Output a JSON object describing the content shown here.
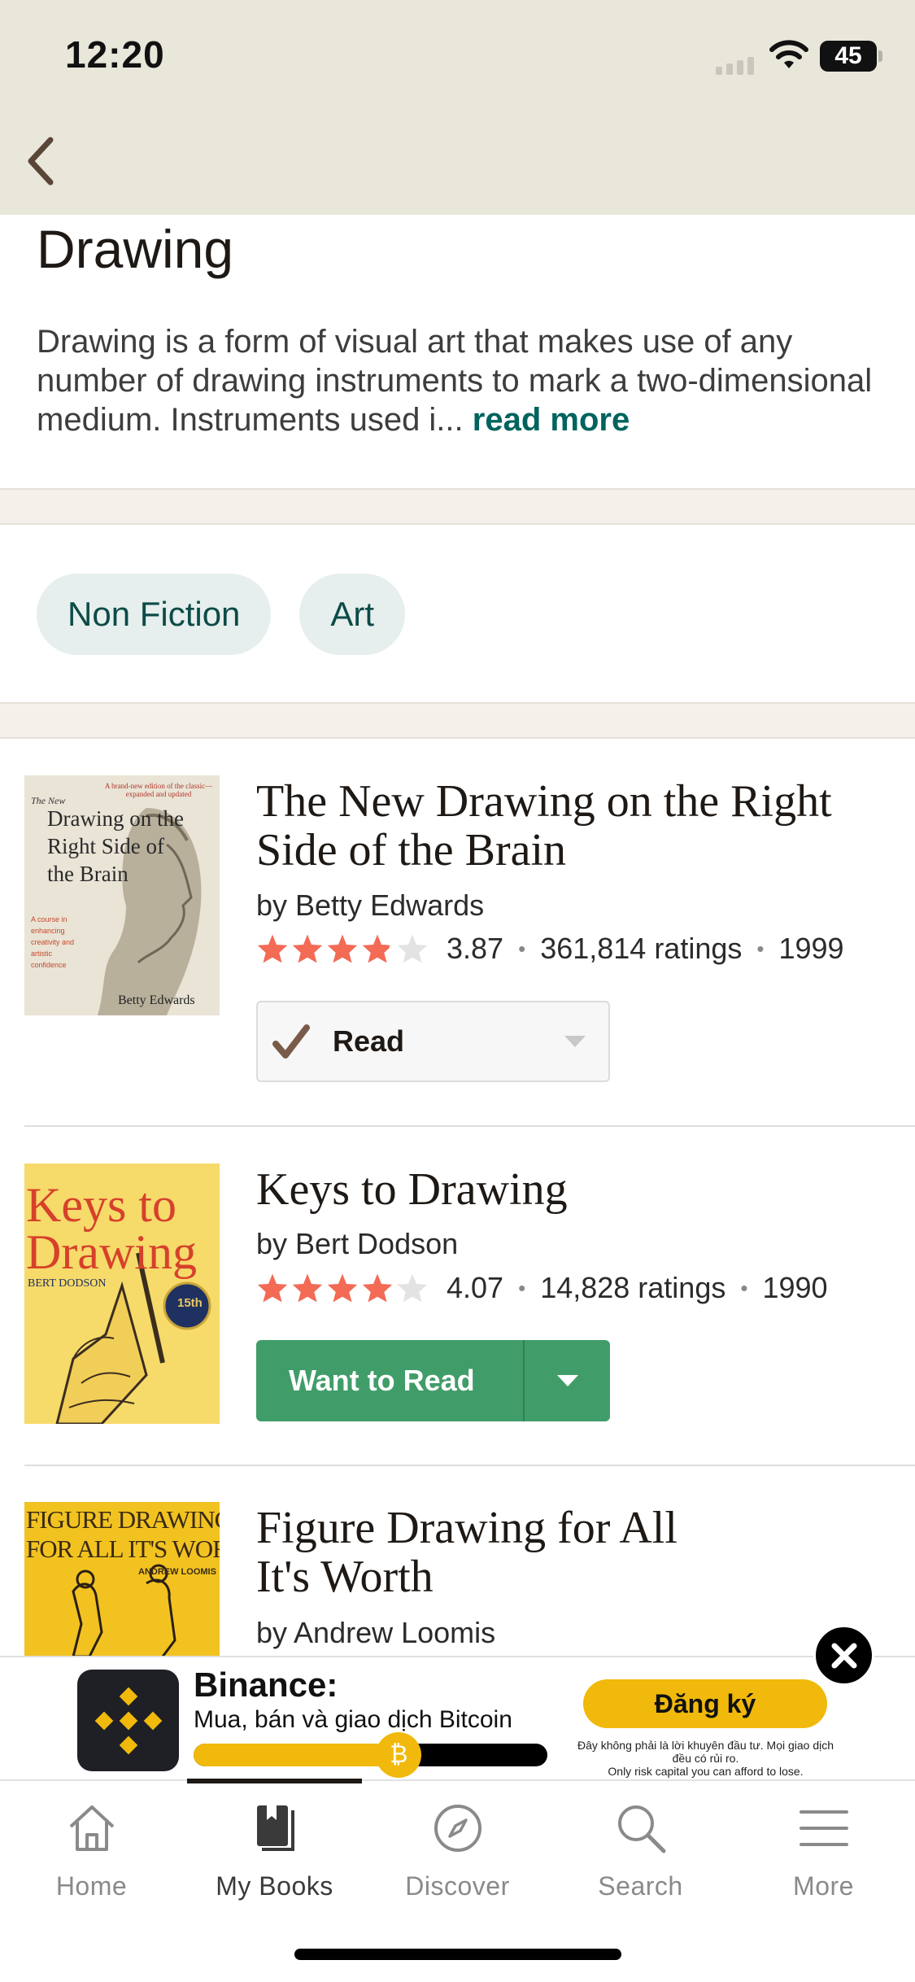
{
  "status_bar": {
    "time": "12:20",
    "battery": "45"
  },
  "genre": {
    "title": "Drawing",
    "description": "Drawing is a form of visual art that makes use of any number of drawing instruments to mark a two-dimensional medium. Instruments used i...",
    "read_more": "read more"
  },
  "tags": [
    "Non Fiction",
    "Art"
  ],
  "books": [
    {
      "title": "The New Drawing on the Right Side of the Brain",
      "author": "by Betty Edwards",
      "rating": "3.87",
      "ratings_count": "361,814 ratings",
      "year": "1999",
      "stars_filled": 3.87,
      "shelf_label": "Read",
      "cover": {
        "small_top": "A brand-new edition of the classic—expanded and updated",
        "the_new": "The New",
        "line1": "Drawing on the",
        "line2": "Right Side of",
        "line3": "the Brain",
        "side_text": "A course in enhancing creativity and artistic confidence",
        "author": "Betty Edwards"
      }
    },
    {
      "title": "Keys to Drawing",
      "author": "by Bert Dodson",
      "rating": "4.07",
      "ratings_count": "14,828 ratings",
      "year": "1990",
      "stars_filled": 4.07,
      "shelf_label": "Want to Read",
      "cover": {
        "line1": "Keys to",
        "line2": "Drawing",
        "author": "BERT DODSON",
        "badge": "15th"
      }
    },
    {
      "title": "Figure Drawing for All It's Worth",
      "author": "by Andrew Loomis",
      "cover": {
        "line1": "FIGURE DRAWING",
        "line2": "FOR ALL IT'S WORTH",
        "author": "ANDREW LOOMIS"
      }
    }
  ],
  "ad": {
    "title": "Binance:",
    "subtitle": "Mua, bán và giao dịch Bitcoin",
    "cta": "Đăng ký",
    "disclaimer_1": "Đây không phải là lời khuyên đầu tư. Mọi giao dịch đều có rủi ro.",
    "disclaimer_2": "Only risk capital you can afford to lose.",
    "progress": 0.58,
    "coin_symbol": "₿"
  },
  "tabs": [
    {
      "label": "Home",
      "icon": "home-icon"
    },
    {
      "label": "My Books",
      "icon": "book-icon",
      "active": true
    },
    {
      "label": "Discover",
      "icon": "compass-icon"
    },
    {
      "label": "Search",
      "icon": "search-icon"
    },
    {
      "label": "More",
      "icon": "menu-icon"
    }
  ],
  "colors": {
    "header_bg": "#e9e6da",
    "accent_teal": "#00635d",
    "chip_bg": "#e6efed",
    "star": "#f36a55",
    "want_green": "#409d69",
    "binance_yellow": "#f0b90b"
  }
}
